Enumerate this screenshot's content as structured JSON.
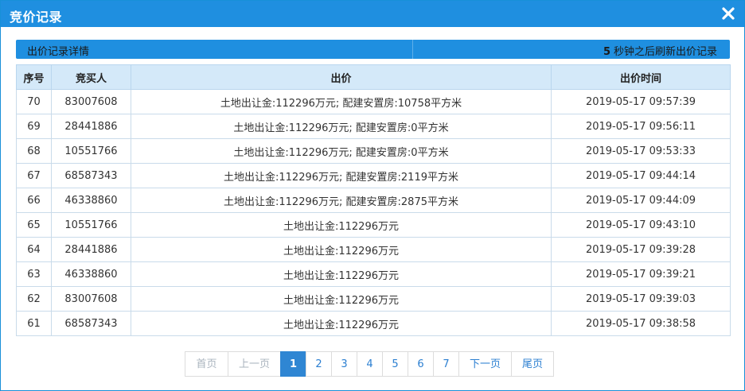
{
  "dialog": {
    "title": "竞价记录",
    "subheader_left": "出价记录详情",
    "countdown_seconds": "5",
    "countdown_text": "秒钟之后刷新出价记录"
  },
  "table": {
    "headers": [
      "序号",
      "竞买人",
      "出价",
      "出价时间"
    ],
    "rows": [
      [
        "70",
        "83007608",
        "土地出让金:112296万元; 配建安置房:10758平方米",
        "2019-05-17 09:57:39"
      ],
      [
        "69",
        "28441886",
        "土地出让金:112296万元; 配建安置房:0平方米",
        "2019-05-17 09:56:11"
      ],
      [
        "68",
        "10551766",
        "土地出让金:112296万元; 配建安置房:0平方米",
        "2019-05-17 09:53:33"
      ],
      [
        "67",
        "68587343",
        "土地出让金:112296万元; 配建安置房:2119平方米",
        "2019-05-17 09:44:14"
      ],
      [
        "66",
        "46338860",
        "土地出让金:112296万元; 配建安置房:2875平方米",
        "2019-05-17 09:44:09"
      ],
      [
        "65",
        "10551766",
        "土地出让金:112296万元",
        "2019-05-17 09:43:10"
      ],
      [
        "64",
        "28441886",
        "土地出让金:112296万元",
        "2019-05-17 09:39:28"
      ],
      [
        "63",
        "46338860",
        "土地出让金:112296万元",
        "2019-05-17 09:39:21"
      ],
      [
        "62",
        "83007608",
        "土地出让金:112296万元",
        "2019-05-17 09:39:03"
      ],
      [
        "61",
        "68587343",
        "土地出让金:112296万元",
        "2019-05-17 09:38:58"
      ]
    ]
  },
  "pager": {
    "first": "首页",
    "prev": "上一页",
    "pages": [
      "1",
      "2",
      "3",
      "4",
      "5",
      "6",
      "7"
    ],
    "current": "1",
    "next": "下一页",
    "last": "尾页"
  },
  "colors": {
    "titlebar": "#1f8fe0",
    "header_bg": "#d4e9f9",
    "active_page": "#2f86d3"
  },
  "icons": {
    "close": "close-icon"
  }
}
